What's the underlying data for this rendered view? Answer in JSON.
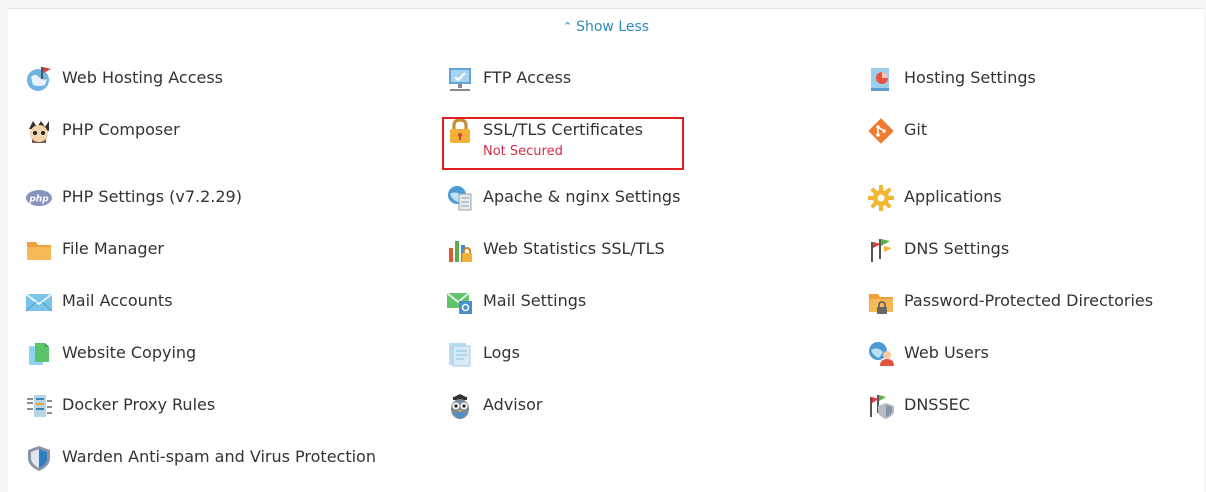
{
  "toggle": {
    "label": "Show Less"
  },
  "columns": {
    "col1": [
      {
        "label": "Web Hosting Access",
        "icon": "globe-flag-icon"
      },
      {
        "label": "PHP Composer",
        "icon": "composer-icon"
      },
      {
        "label": "PHP Settings (v7.2.29)",
        "icon": "php-icon"
      },
      {
        "label": "File Manager",
        "icon": "folder-icon"
      },
      {
        "label": "Mail Accounts",
        "icon": "envelope-icon"
      },
      {
        "label": "Website Copying",
        "icon": "copy-pages-icon"
      },
      {
        "label": "Docker Proxy Rules",
        "icon": "docker-rules-icon"
      },
      {
        "label": "Warden Anti-spam and Virus Protection",
        "icon": "shield-icon"
      }
    ],
    "col2": [
      {
        "label": "FTP Access",
        "icon": "ftp-monitor-icon"
      },
      {
        "label": "SSL/TLS Certificates",
        "sublabel": "Not Secured",
        "icon": "padlock-icon"
      },
      {
        "label": "Apache & nginx Settings",
        "icon": "server-globe-icon"
      },
      {
        "label": "Web Statistics SSL/TLS",
        "icon": "stats-lock-icon"
      },
      {
        "label": "Mail Settings",
        "icon": "mail-settings-icon"
      },
      {
        "label": "Logs",
        "icon": "logs-icon"
      },
      {
        "label": "Advisor",
        "icon": "owl-icon"
      }
    ],
    "col3": [
      {
        "label": "Hosting Settings",
        "icon": "hosting-settings-icon"
      },
      {
        "label": "Git",
        "icon": "git-icon"
      },
      {
        "label": "Applications",
        "icon": "gear-icon"
      },
      {
        "label": "DNS Settings",
        "icon": "dns-flags-icon"
      },
      {
        "label": "Password-Protected Directories",
        "icon": "locked-folder-icon"
      },
      {
        "label": "Web Users",
        "icon": "web-user-icon"
      },
      {
        "label": "DNSSEC",
        "icon": "dnssec-icon"
      }
    ]
  },
  "colors": {
    "link": "#2e8ab8",
    "warning": "#d02d4b",
    "highlight": "#e02020",
    "text": "#333333"
  }
}
